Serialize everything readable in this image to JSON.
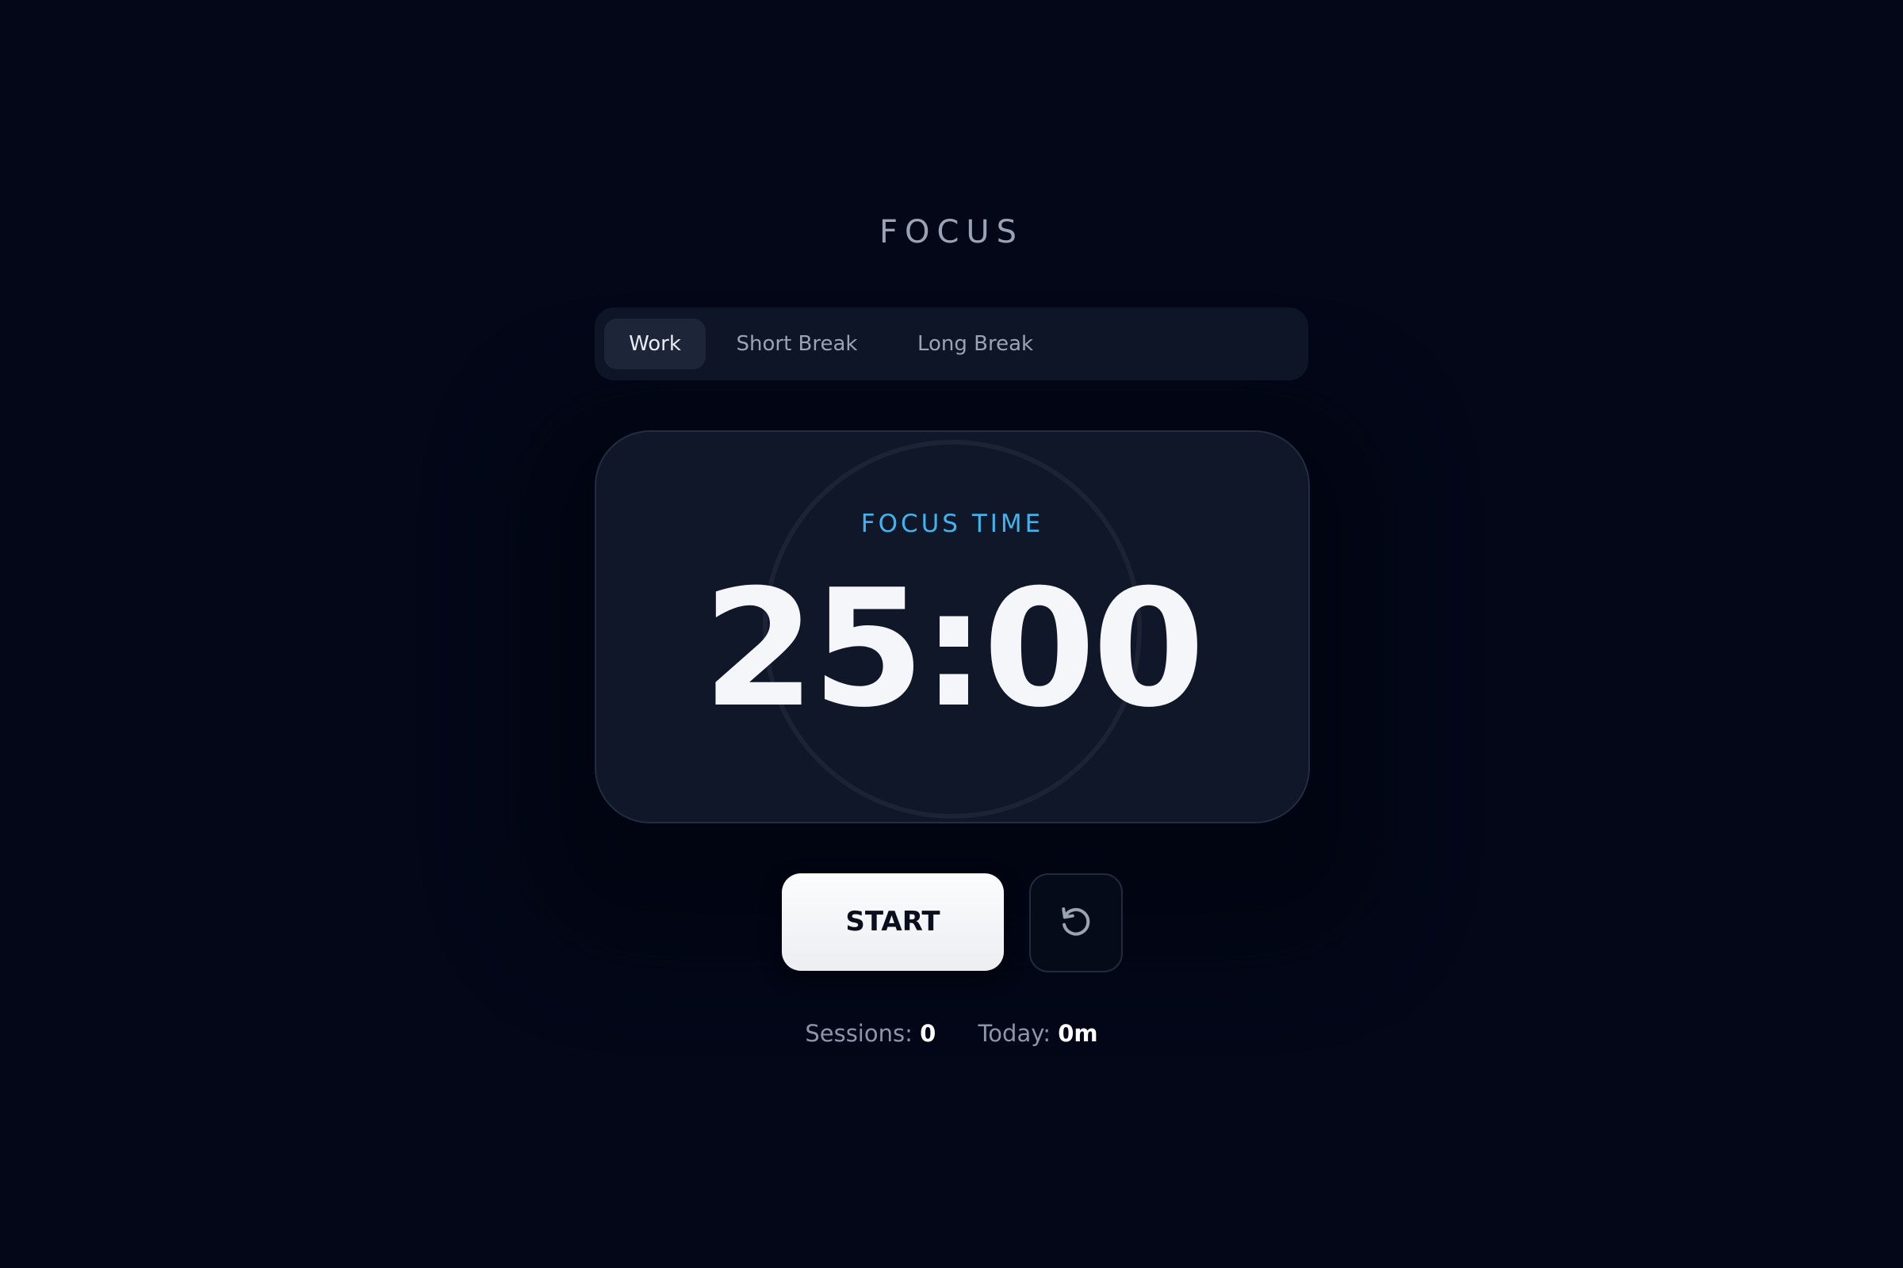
{
  "app": {
    "title": "FOCUS"
  },
  "tabs": [
    {
      "label": "Work",
      "active": true
    },
    {
      "label": "Short Break",
      "active": false
    },
    {
      "label": "Long Break",
      "active": false
    }
  ],
  "timer": {
    "session_label": "FOCUS TIME",
    "time": "25:00",
    "progress": 0
  },
  "controls": {
    "start_label": "START",
    "reset_icon": "reset-icon"
  },
  "stats": {
    "sessions_label": "Sessions:",
    "sessions_value": "0",
    "today_label": "Today:",
    "today_value": "0m"
  },
  "colors": {
    "background": "#030718",
    "card": "#0f1729",
    "accent": "#3fb4ee",
    "text_primary": "#f4f6fa",
    "text_muted": "#9aa3b4"
  }
}
